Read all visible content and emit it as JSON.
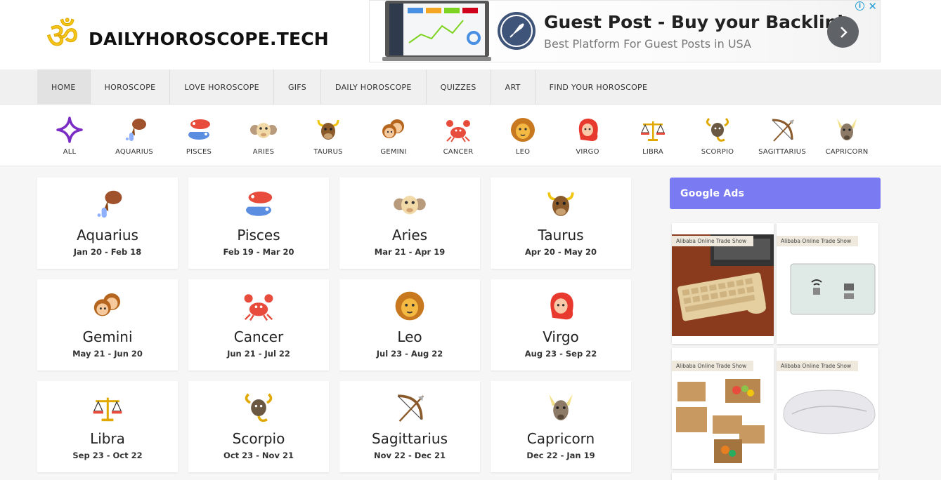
{
  "site": {
    "logo_text": "DAILYHOROSCOPE.TECH"
  },
  "ad_banner": {
    "title": "Guest Post - Buy your Backlink",
    "subtitle": "Best Platform For Guest Posts in USA",
    "info_icon": "info-icon",
    "close_icon": "close-icon"
  },
  "nav": {
    "items": [
      {
        "label": "HOME",
        "active": true
      },
      {
        "label": "HOROSCOPE"
      },
      {
        "label": "LOVE HOROSCOPE"
      },
      {
        "label": "GIFS"
      },
      {
        "label": "DAILY HOROSCOPE"
      },
      {
        "label": "QUIZZES"
      },
      {
        "label": "ART"
      },
      {
        "label": "FIND YOUR HOROSCOPE"
      }
    ]
  },
  "zodiac_strip": [
    {
      "label": "ALL",
      "icon": "star-icon"
    },
    {
      "label": "AQUARIUS",
      "icon": "aquarius-icon"
    },
    {
      "label": "PISCES",
      "icon": "pisces-icon"
    },
    {
      "label": "ARIES",
      "icon": "aries-icon"
    },
    {
      "label": "TAURUS",
      "icon": "taurus-icon"
    },
    {
      "label": "GEMINI",
      "icon": "gemini-icon"
    },
    {
      "label": "CANCER",
      "icon": "cancer-icon"
    },
    {
      "label": "LEO",
      "icon": "leo-icon"
    },
    {
      "label": "VIRGO",
      "icon": "virgo-icon"
    },
    {
      "label": "LIBRA",
      "icon": "libra-icon"
    },
    {
      "label": "SCORPIO",
      "icon": "scorpio-icon"
    },
    {
      "label": "SAGITTARIUS",
      "icon": "sagittarius-icon"
    },
    {
      "label": "CAPRICORN",
      "icon": "capricorn-icon"
    }
  ],
  "cards": [
    {
      "name": "Aquarius",
      "dates": "Jan 20 - Feb 18"
    },
    {
      "name": "Pisces",
      "dates": "Feb 19 - Mar 20"
    },
    {
      "name": "Aries",
      "dates": "Mar 21 - Apr 19"
    },
    {
      "name": "Taurus",
      "dates": "Apr 20 - May 20"
    },
    {
      "name": "Gemini",
      "dates": "May 21 - Jun 20"
    },
    {
      "name": "Cancer",
      "dates": "Jun 21 - Jul 22"
    },
    {
      "name": "Leo",
      "dates": "Jul 23 - Aug 22"
    },
    {
      "name": "Virgo",
      "dates": "Aug 23 - Sep 22"
    },
    {
      "name": "Libra",
      "dates": "Sep 23 - Oct 22"
    },
    {
      "name": "Scorpio",
      "dates": "Oct 23 - Nov 21"
    },
    {
      "name": "Sagittarius",
      "dates": "Nov 22 - Dec 21"
    },
    {
      "name": "Capricorn",
      "dates": "Dec 22 - Jan 19"
    }
  ],
  "sidebar": {
    "heading": "Google Ads",
    "heading_color": "#7a7af2",
    "ad_tag": "Alibaba Online Trade Show"
  },
  "colors": {
    "accent_purple": "#7a7af2",
    "all_star": "#7b2cc4"
  }
}
